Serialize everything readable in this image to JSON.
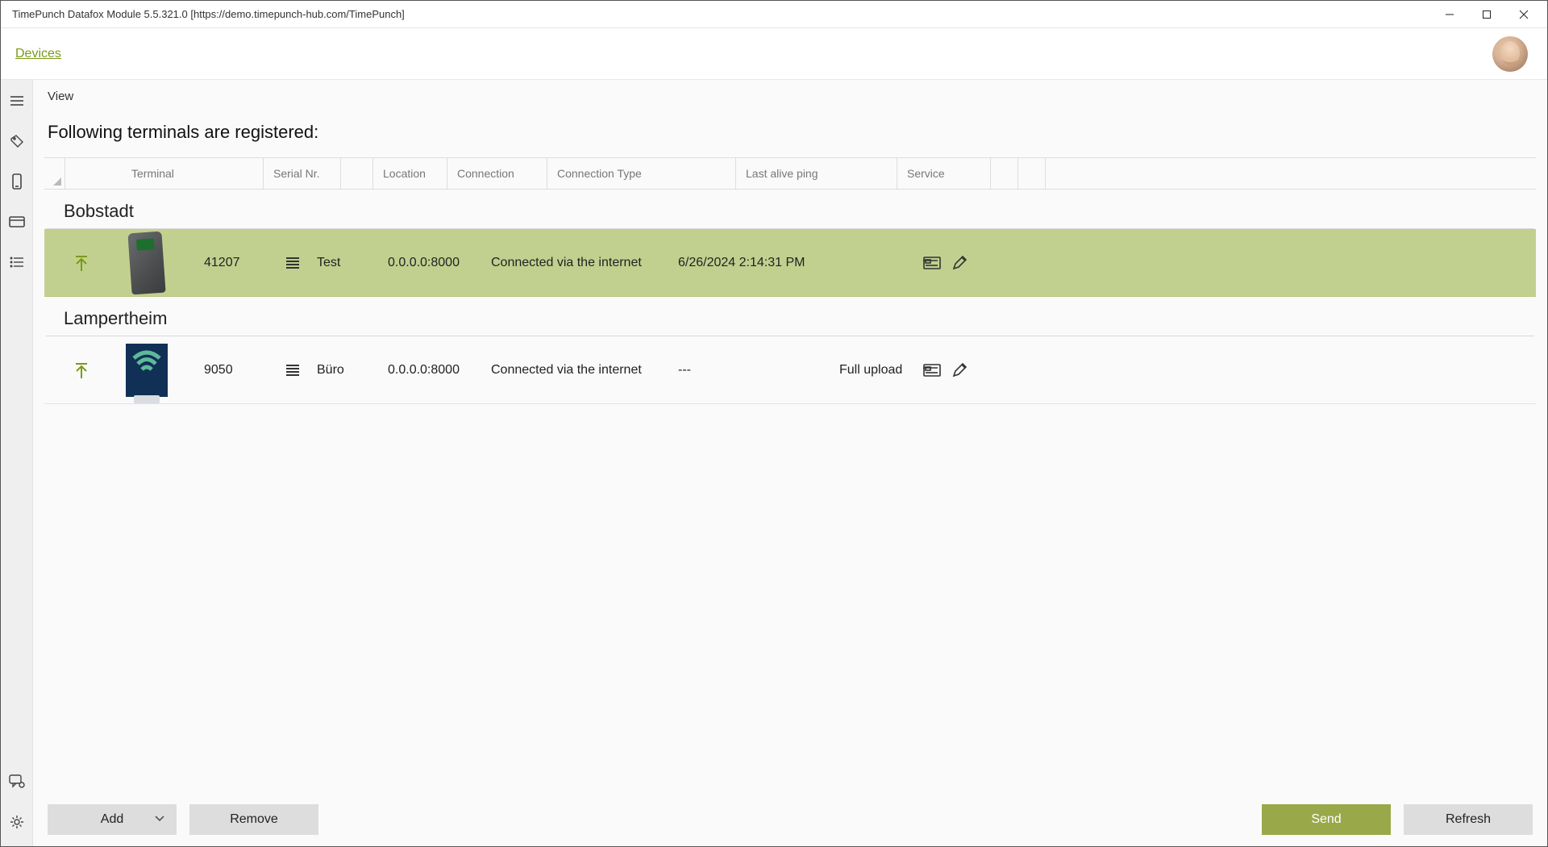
{
  "window": {
    "title": "TimePunch Datafox Module 5.5.321.0  [https://demo.timepunch-hub.com/TimePunch]"
  },
  "breadcrumb": {
    "devices": "Devices"
  },
  "toolbar": {
    "view": "View"
  },
  "subtitle": "Following terminals are registered:",
  "columns": {
    "terminal": "Terminal",
    "serial": "Serial Nr.",
    "location": "Location",
    "connection": "Connection",
    "connection_type": "Connection Type",
    "last_ping": "Last alive ping",
    "service": "Service"
  },
  "groups": [
    {
      "name": "Bobstadt",
      "rows": [
        {
          "selected": true,
          "serial": "41207",
          "location": "Test",
          "connection": "0.0.0.0:8000",
          "connection_type": "Connected via the internet",
          "ping": "6/26/2024 2:14:31 PM",
          "service": "",
          "device_style": "hardware"
        }
      ]
    },
    {
      "name": "Lampertheim",
      "rows": [
        {
          "selected": false,
          "serial": "9050",
          "location": "Büro",
          "connection": "0.0.0.0:8000",
          "connection_type": "Connected via the internet",
          "ping": "---",
          "service": "Full upload",
          "device_style": "wifi"
        }
      ]
    }
  ],
  "footer": {
    "add": "Add",
    "remove": "Remove",
    "send": "Send",
    "refresh": "Refresh"
  }
}
